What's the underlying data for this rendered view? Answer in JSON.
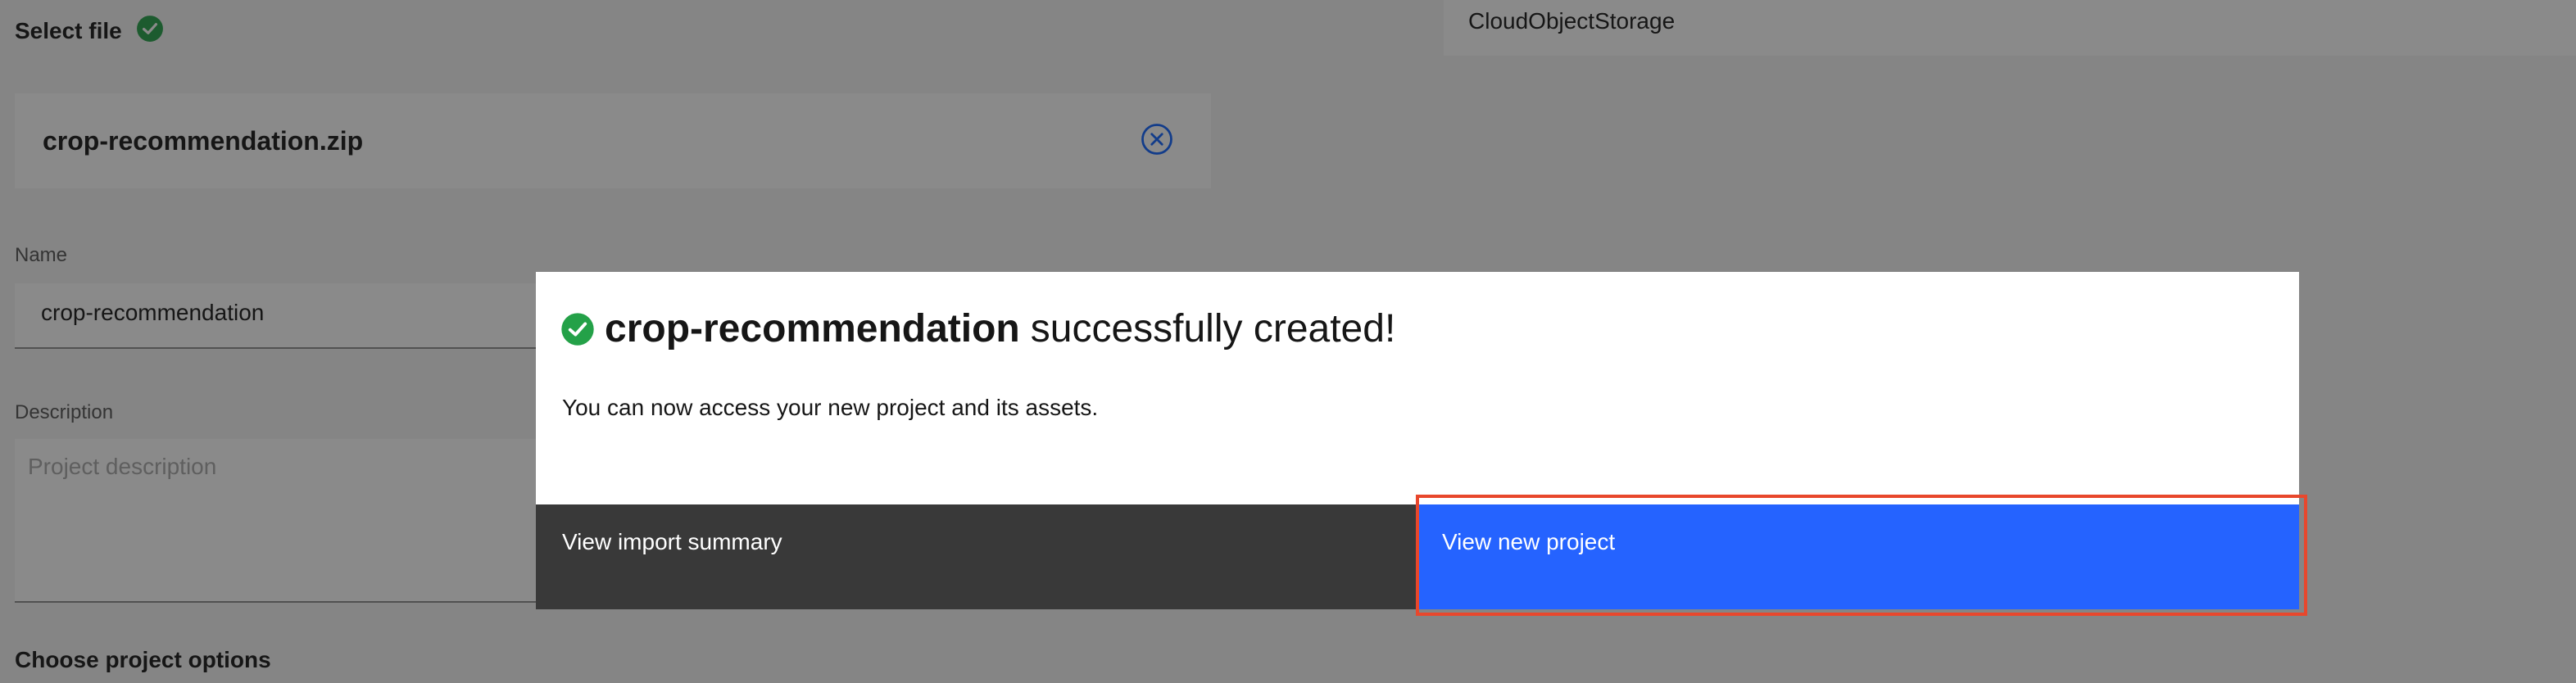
{
  "background": {
    "select_file_label": "Select file",
    "file": {
      "name": "crop-recommendation.zip"
    },
    "name_field": {
      "label": "Name",
      "value": "crop-recommendation"
    },
    "description_field": {
      "label": "Description",
      "placeholder": "Project description"
    },
    "choose_options_label": "Choose project options",
    "storage_value": "CloudObjectStorage"
  },
  "modal": {
    "project_name": "crop-recommendation",
    "title_suffix": "successfully created!",
    "body": "You can now access your new project and its assets.",
    "secondary_button_label": "View import summary",
    "primary_button_label": "View new project"
  },
  "colors": {
    "primary": "#2563ff",
    "secondary": "#393939",
    "success": "#24a148",
    "highlight": "#e8472c"
  },
  "icons": {
    "success": "checkmark-filled-icon",
    "remove_file": "close-outline-icon"
  }
}
